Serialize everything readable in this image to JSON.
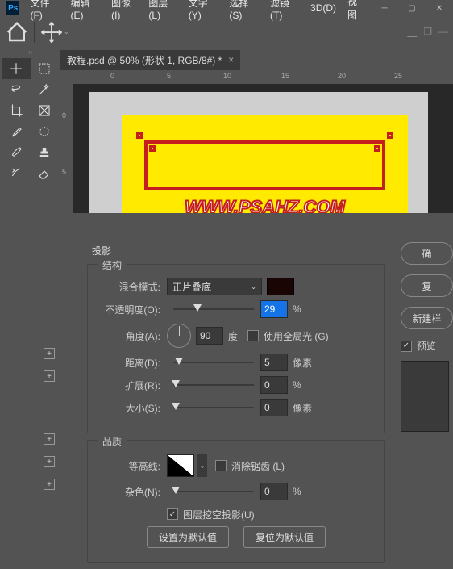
{
  "menu": {
    "file": "文件(F)",
    "edit": "编辑(E)",
    "image": "图像(I)",
    "layer": "图层(L)",
    "type": "文字(Y)",
    "select": "选择(S)",
    "filter": "滤镜(T)",
    "threed": "3D(D)",
    "view": "视图"
  },
  "tab": {
    "title": "教程.psd @ 50% (形状 1, RGB/8#) *"
  },
  "ruler": {
    "t0": "0",
    "t5": "5",
    "t10": "10",
    "t15": "15",
    "t20": "20",
    "t25": "25",
    "v0": "0",
    "v5": "5"
  },
  "canvas": {
    "url": "WWW.PSAHZ.COM"
  },
  "dialog": {
    "title": "投影",
    "struct": "结构",
    "blend_label": "混合模式:",
    "blend_value": "正片叠底",
    "opacity_label": "不透明度(O):",
    "opacity_value": "29",
    "opacity_unit": "%",
    "angle_label": "角度(A):",
    "angle_value": "90",
    "angle_unit": "度",
    "global_light": "使用全局光 (G)",
    "distance_label": "距离(D):",
    "distance_value": "5",
    "distance_unit": "像素",
    "spread_label": "扩展(R):",
    "spread_value": "0",
    "spread_unit": "%",
    "size_label": "大小(S):",
    "size_value": "0",
    "size_unit": "像素",
    "quality": "品质",
    "contour_label": "等高线:",
    "antialias": "消除锯齿 (L)",
    "noise_label": "杂色(N):",
    "noise_value": "0",
    "noise_unit": "%",
    "knockout": "图层挖空投影(U)",
    "set_default": "设置为默认值",
    "reset_default": "复位为默认值"
  },
  "side": {
    "ok": "确",
    "reset": "复",
    "new_style": "新建样",
    "preview": "预览"
  }
}
